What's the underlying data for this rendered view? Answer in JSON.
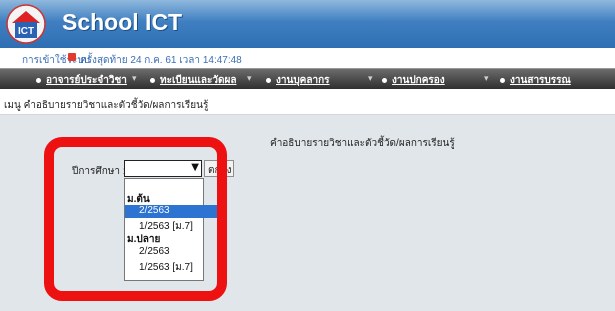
{
  "app": {
    "title": "School ICT"
  },
  "status": {
    "login": "การเข้าใช้ระบบ",
    "last_login": "ครั้งสุดท้าย  24 ก.ค. 61  เวลา 14:47:48"
  },
  "nav": {
    "items": [
      {
        "label": "อาจารย์ประจำวิชา"
      },
      {
        "label": "ทะเบียนและวัดผล"
      },
      {
        "label": "งานบุคลากร"
      },
      {
        "label": "งานปกครอง"
      },
      {
        "label": "งานสารบรรณ"
      }
    ]
  },
  "breadcrumb": {
    "text": "เมนู คำอธิบายรายวิชาและตัวชี้วัด/ผลการเรียนรู้"
  },
  "main": {
    "title": "คำอธิบายรายวิชาและตัวชี้วัด/ผลการเรียนรู้",
    "year_label": "ปีการศึกษา :",
    "ok_button": "ตกลง"
  },
  "dropdown": {
    "groups": [
      {
        "label": "ม.ต้น",
        "options": [
          "2/2563",
          "1/2563 [ม.7]"
        ]
      },
      {
        "label": "ม.ปลาย",
        "options": [
          "2/2563",
          "1/2563 [ม.7]"
        ]
      }
    ],
    "highlighted": "2/2563"
  },
  "colors": {
    "accent": "#2c73d2",
    "highlight_ring": "#ee1111",
    "header": "#3f7fc1"
  },
  "icons": {
    "logo": "school-house-icon",
    "logout": "logout-icon",
    "nav_bullet": "bullet-icon",
    "select_arrow": "chevron-down-icon"
  }
}
